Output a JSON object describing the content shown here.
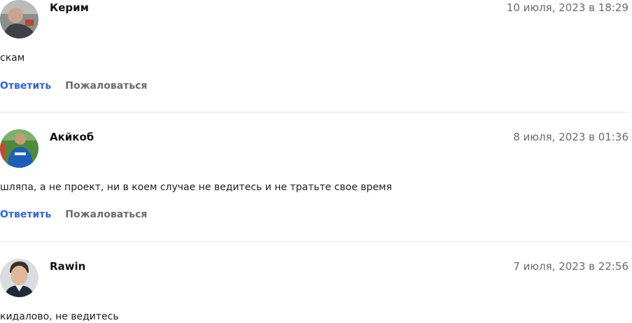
{
  "comments": [
    {
      "author": "Керим",
      "date": "10 июля, 2023 в 18:29",
      "text": "скам",
      "reply_label": "Ответить",
      "report_label": "Пожаловаться"
    },
    {
      "author": "Акйкоб",
      "date": "8 июля, 2023 в 01:36",
      "text": "шляпа, а не проект, ни в коем случае не ведитесь и не тратьте свое время",
      "reply_label": "Ответить",
      "report_label": "Пожаловаться"
    },
    {
      "author": "Rawin",
      "date": "7 июля, 2023 в 22:56",
      "text": "кидалово, не ведитесь"
    }
  ],
  "colors": {
    "link": "#2f63e0",
    "muted": "#6b6b6b",
    "divider": "#e6e7ef"
  }
}
